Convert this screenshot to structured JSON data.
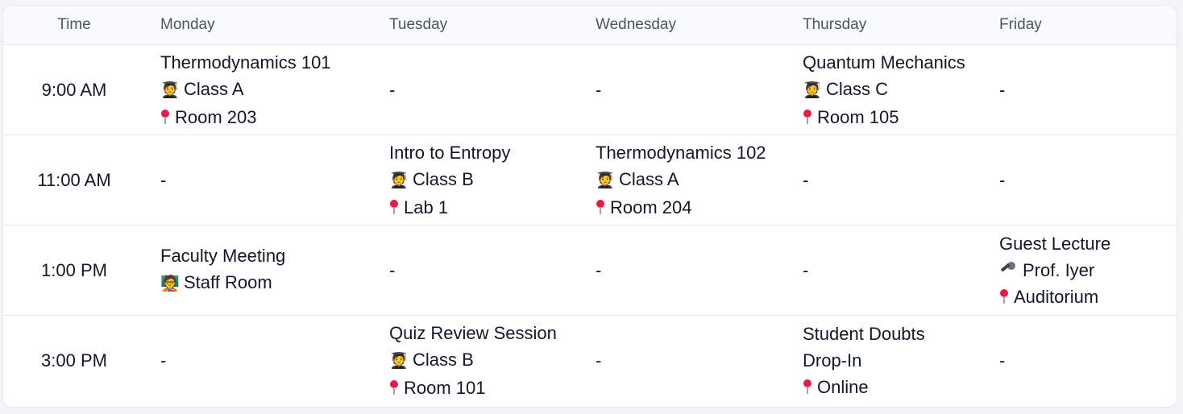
{
  "columns": [
    "Time",
    "Monday",
    "Tuesday",
    "Wednesday",
    "Thursday",
    "Friday"
  ],
  "empty_marker": "-",
  "rows": [
    {
      "time": "9:00 AM",
      "cells": {
        "monday": {
          "title": "Thermodynamics 101",
          "line2_icon": "student-icon",
          "line2": "Class A",
          "line3_icon": "pin-icon",
          "line3": "Room 203"
        },
        "tuesday": null,
        "wednesday": null,
        "thursday": {
          "title": "Quantum Mechanics",
          "line2_icon": "student-icon",
          "line2": "Class C",
          "line3_icon": "pin-icon",
          "line3": "Room 105"
        },
        "friday": null
      }
    },
    {
      "time": "11:00 AM",
      "cells": {
        "monday": null,
        "tuesday": {
          "title": "Intro to Entropy",
          "line2_icon": "student-icon",
          "line2": "Class B",
          "line3_icon": "pin-icon",
          "line3": "Lab 1"
        },
        "wednesday": {
          "title": "Thermodynamics 102",
          "line2_icon": "student-icon",
          "line2": "Class A",
          "line3_icon": "pin-icon",
          "line3": "Room 204"
        },
        "thursday": null,
        "friday": null
      }
    },
    {
      "time": "1:00 PM",
      "cells": {
        "monday": {
          "title": "Faculty Meeting",
          "line2_icon": "teacher-icon",
          "line2": "Staff Room"
        },
        "tuesday": null,
        "wednesday": null,
        "thursday": null,
        "friday": {
          "title": "Guest Lecture",
          "line2_icon": "microphone-icon",
          "line2": "Prof. Iyer",
          "line3_icon": "pin-icon",
          "line3": "Auditorium"
        }
      }
    },
    {
      "time": "3:00 PM",
      "cells": {
        "monday": null,
        "tuesday": {
          "title": "Quiz Review Session",
          "line2_icon": "student-icon",
          "line2": "Class B",
          "line3_icon": "pin-icon",
          "line3": "Room 101"
        },
        "wednesday": null,
        "thursday": {
          "title": "Student Doubts",
          "line2": "Drop-In",
          "line3_icon": "pin-icon",
          "line3": "Online"
        },
        "friday": null
      }
    }
  ],
  "glyphs": {
    "student-icon": "🧑‍🎓",
    "teacher-icon": "🧑‍🏫",
    "microphone-icon": "",
    "pin-icon": ""
  }
}
